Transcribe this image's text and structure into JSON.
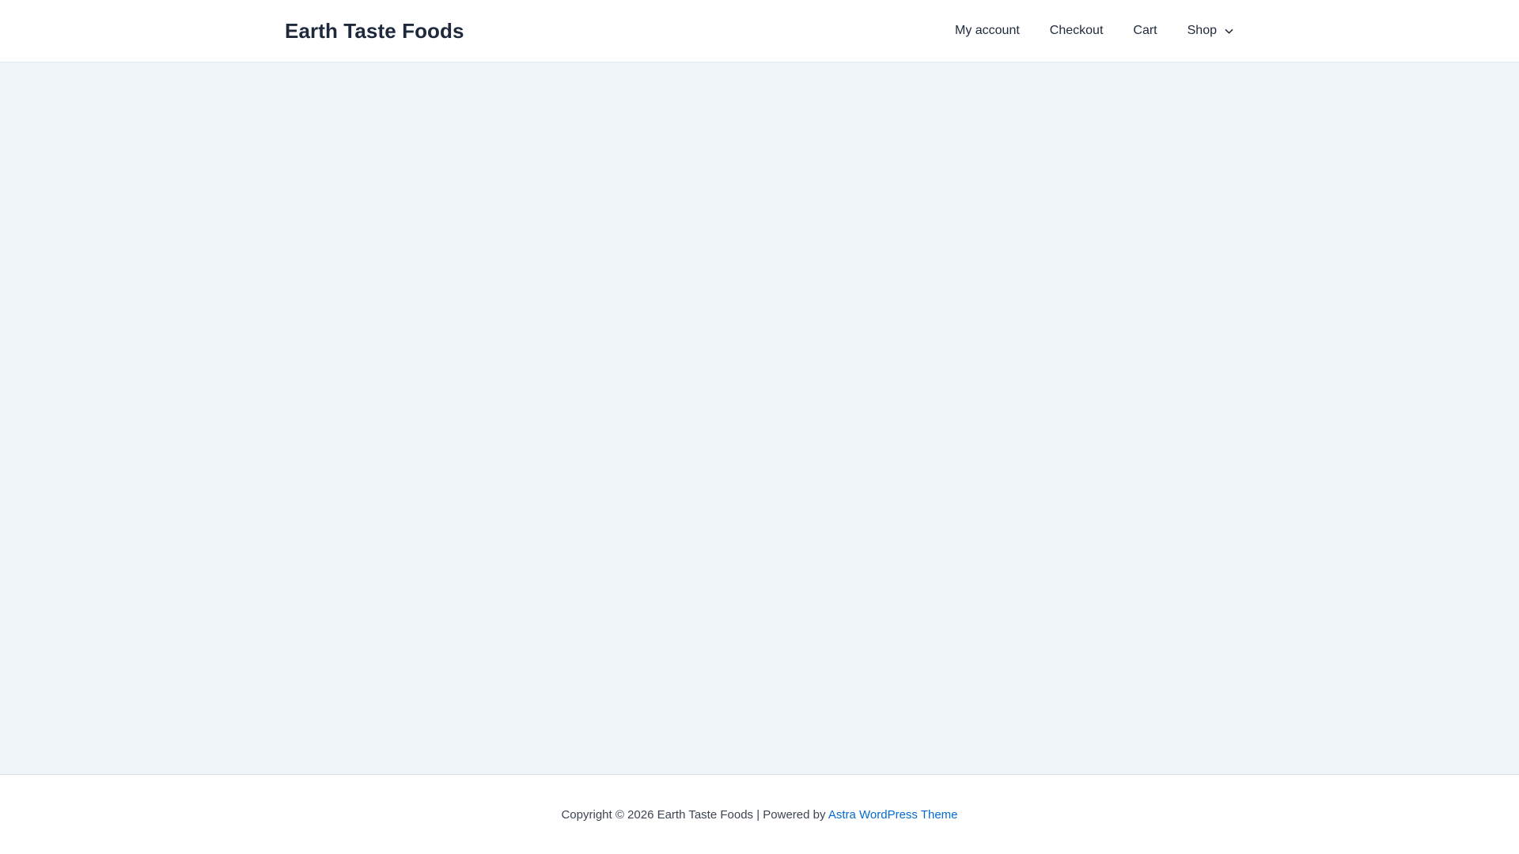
{
  "header": {
    "site_title": "Earth Taste Foods",
    "nav": [
      {
        "label": "My account"
      },
      {
        "label": "Checkout"
      },
      {
        "label": "Cart"
      },
      {
        "label": "Shop",
        "has_dropdown": true,
        "dropdown_icon": "chevron-down-icon"
      }
    ]
  },
  "main": {
    "content": ""
  },
  "footer": {
    "copyright_text": "Copyright © 2026 Earth Taste Foods | Powered by",
    "theme_link_label": "Astra WordPress Theme"
  },
  "colors": {
    "accent_link": "#046bd2",
    "heading_text": "#1e293b",
    "body_text": "#3d4451",
    "main_background": "#f0f5fa",
    "header_background": "#ffffff",
    "footer_background": "#ffffff"
  }
}
